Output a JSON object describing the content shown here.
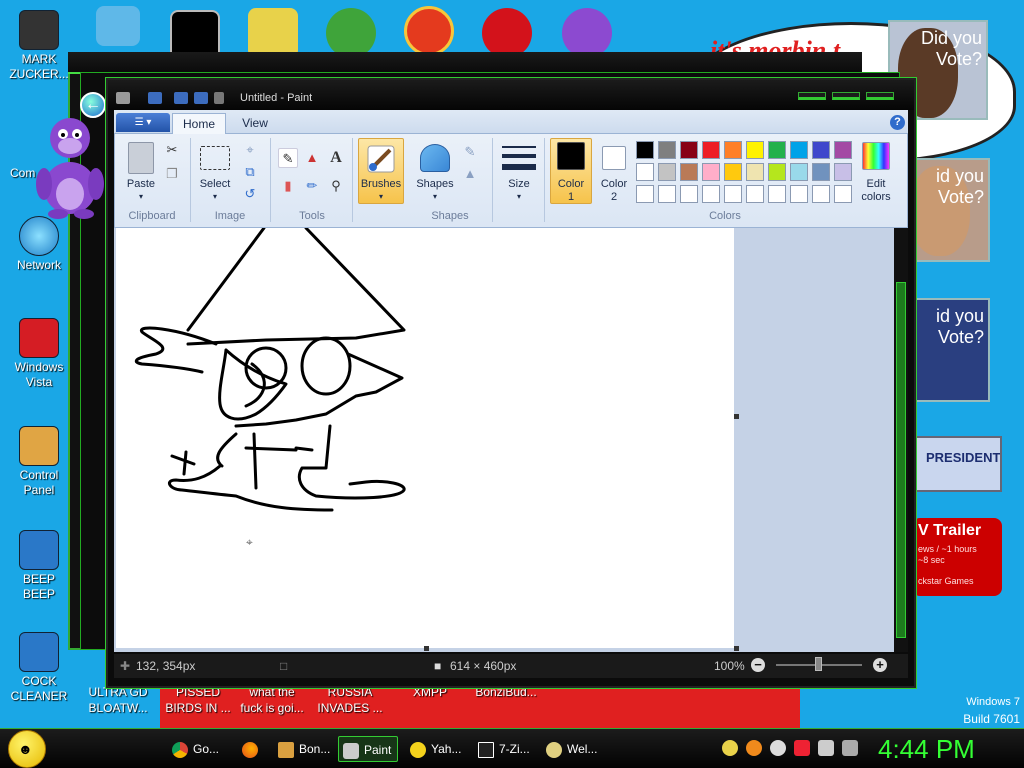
{
  "desktop": {
    "icons": [
      {
        "name": "mark-zuckerberg-icon",
        "label": "MARK\nZUCKER..."
      },
      {
        "name": "computer-icon",
        "label": "Com"
      },
      {
        "name": "network-icon",
        "label": "Network"
      },
      {
        "name": "windows-vista-icon",
        "label": "Windows\nVista"
      },
      {
        "name": "control-panel-icon",
        "label": "Control\nPanel"
      },
      {
        "name": "beep-beep-icon",
        "label": "BEEP\nBEEP"
      },
      {
        "name": "cock-cleaner-icon",
        "label": "COCK\nCLEANER"
      }
    ],
    "bottom_labels": [
      "ULTRA GD\nBLOATW...",
      "PISSED\nBIRDS IN ...",
      "what the\nfuck is goi...",
      "RUSSIA\nINVADES ...",
      "XMPP",
      "BonziBud..."
    ],
    "banner_text": "it's morbin t",
    "posters": [
      "Did you\nVote?",
      "id you\nVote?",
      "id you\nVote?",
      "PRESIDENT"
    ],
    "trailer": {
      "title": "V Trailer",
      "sub": "ews / ~1 hours\n~8 sec",
      "foot": "ckstar Games"
    },
    "watermark": {
      "line1": "Windows 7",
      "line2": "Build 7601"
    }
  },
  "paint": {
    "title": "Untitled - Paint",
    "tabs": {
      "home": "Home",
      "view": "View"
    },
    "groups": {
      "clipboard": "Clipboard",
      "image": "Image",
      "tools": "Tools",
      "shapes": "Shapes",
      "colors": "Colors"
    },
    "buttons": {
      "paste": "Paste",
      "select": "Select",
      "brushes": "Brushes",
      "shapes": "Shapes",
      "size": "Size",
      "color1": "Color\n1",
      "color2": "Color\n2",
      "edit_colors": "Edit\ncolors"
    },
    "palette_row1": [
      "#000000",
      "#7f7f7f",
      "#880015",
      "#ed1c24",
      "#ff7f27",
      "#fff200",
      "#22b14c",
      "#00a2e8",
      "#3f48cc",
      "#a349a4"
    ],
    "palette_row2": [
      "#ffffff",
      "#c3c3c3",
      "#b97a57",
      "#ffaec9",
      "#ffc90e",
      "#efe4b0",
      "#b5e61d",
      "#99d9ea",
      "#7092be",
      "#c8bfe7"
    ],
    "color1_value": "#000000",
    "color2_value": "#ffffff",
    "status": {
      "cursor": "132, 354px",
      "size": "614 × 460px",
      "zoom": "100%"
    }
  },
  "taskbar": {
    "items": [
      "Go...",
      "",
      "Bon...",
      "Paint",
      "Yah...",
      "7-Zi...",
      "Wel..."
    ],
    "clock": "4:44 PM"
  }
}
